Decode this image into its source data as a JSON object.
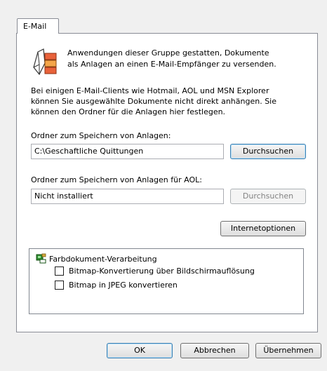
{
  "tab": {
    "label": "E-Mail"
  },
  "intro": {
    "line1": "Anwendungen dieser Gruppe gestatten, Dokumente",
    "line2": "als Anlagen an einen E-Mail-Empfänger zu versenden."
  },
  "info": {
    "line1": "Bei einigen E-Mail-Clients wie Hotmail, AOL und MSN Explorer",
    "line2": "können Sie ausgewählte Dokumente nicht direkt anhängen. Sie",
    "line3": "können den Ordner für die Anlagen hier festlegen."
  },
  "attachments_folder": {
    "label": "Ordner zum Speichern von Anlagen:",
    "value": "C:\\Geschaftliche Quittungen",
    "browse_label": "Durchsuchen"
  },
  "aol_folder": {
    "label": "Ordner zum Speichern von Anlagen für AOL:",
    "value": "Nicht installiert",
    "browse_label": "Durchsuchen"
  },
  "internet_options_label": "Internetoptionen",
  "color_processing": {
    "title": "Farbdokument-Verarbeitung",
    "options": [
      {
        "label": "Bitmap-Konvertierung über Bildschirmauflösung",
        "checked": false
      },
      {
        "label": "Bitmap in JPEG konvertieren",
        "checked": false
      }
    ]
  },
  "buttons": {
    "ok": "OK",
    "cancel": "Abbrechen",
    "apply": "Übernehmen"
  },
  "icons": {
    "app": "mail-documents-icon",
    "tree": "color-tree-icon"
  },
  "colors": {
    "accent_border": "#3c7fb1",
    "panel_border": "#898c95"
  }
}
